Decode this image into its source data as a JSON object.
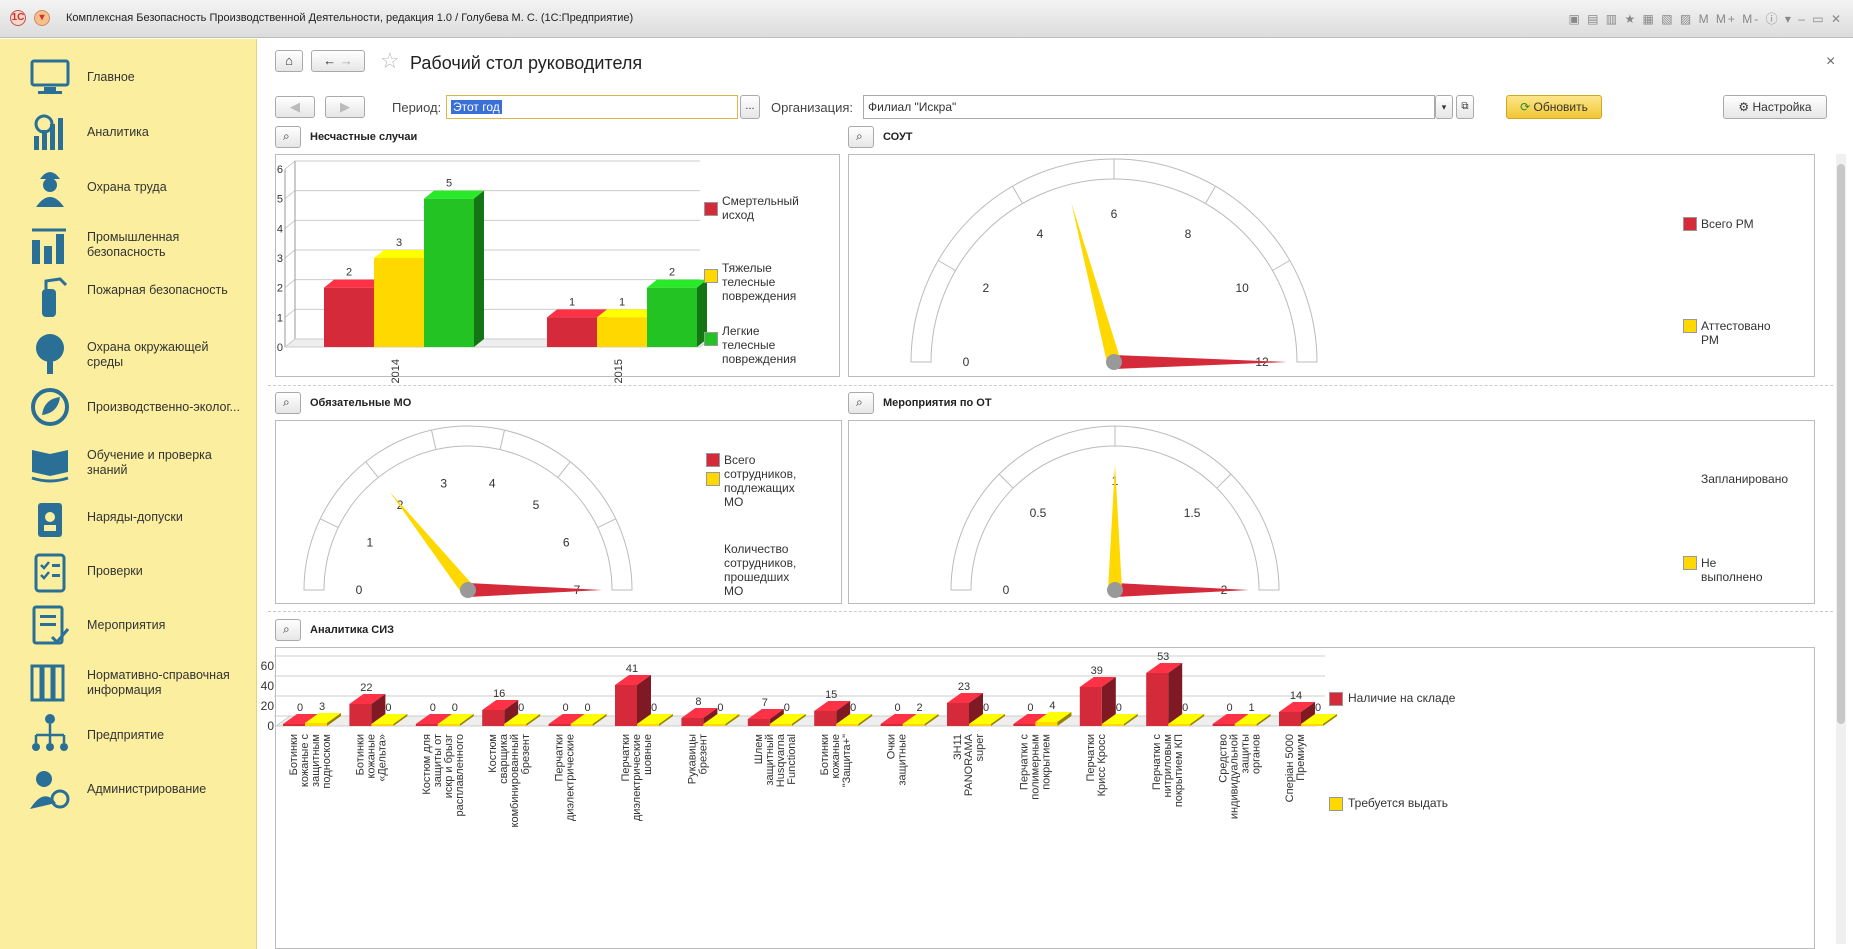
{
  "window": {
    "title": "Комплексная Безопасность Производственной Деятельности, редакция 1.0 / Голубева М. С.  (1С:Предприятие)"
  },
  "sidebar": {
    "items": [
      {
        "label": "Главное",
        "icon": "monitor-icon"
      },
      {
        "label": "Аналитика",
        "icon": "analytics-icon"
      },
      {
        "label": "Охрана труда",
        "icon": "worker-icon"
      },
      {
        "label": "Промышленная безопасность",
        "icon": "factory-icon"
      },
      {
        "label": "Пожарная безопасность",
        "icon": "extinguisher-icon"
      },
      {
        "label": "Охрана окружающей среды",
        "icon": "tree-icon"
      },
      {
        "label": "Производственно-эколог...",
        "icon": "eco-icon"
      },
      {
        "label": "Обучение и проверка знаний",
        "icon": "book-icon"
      },
      {
        "label": "Наряды-допуски",
        "icon": "badge-icon"
      },
      {
        "label": "Проверки",
        "icon": "checklist-icon"
      },
      {
        "label": "Мероприятия",
        "icon": "document-icon"
      },
      {
        "label": "Нормативно-справочная информация",
        "icon": "binders-icon"
      },
      {
        "label": "Предприятие",
        "icon": "org-chart-icon"
      },
      {
        "label": "Администрирование",
        "icon": "admin-icon"
      }
    ]
  },
  "header": {
    "title": "Рабочий стол руководителя",
    "close": "×"
  },
  "toolbar": {
    "period_label": "Период:",
    "period_value": "Этот год",
    "period_more": "...",
    "org_label": "Организация:",
    "org_value": "Филиал \"Искра\"",
    "refresh_label": "Обновить",
    "settings_label": "Настройка"
  },
  "colors": {
    "red": "#d42a3a",
    "yellow": "#ffd800",
    "green": "#22c322",
    "accent": "#f9d74a"
  },
  "panels": {
    "accidents": {
      "title": "Несчастные случаи"
    },
    "sout": {
      "title": "СОУТ"
    },
    "mo": {
      "title": "Обязательные МО"
    },
    "ot": {
      "title": "Мероприятия по ОТ"
    },
    "siz": {
      "title": "Аналитика СИЗ"
    }
  },
  "chart_data": [
    {
      "type": "bar",
      "title": "Несчастные случаи",
      "categories": [
        "2014",
        "2015"
      ],
      "series": [
        {
          "name": "Смертельный исход",
          "values": [
            2,
            1
          ]
        },
        {
          "name": "Тяжелые телесные повреждения",
          "values": [
            3,
            1
          ]
        },
        {
          "name": "Легкие телесные повреждения",
          "values": [
            5,
            2
          ]
        }
      ],
      "ylim": [
        0,
        6
      ],
      "yticks": [
        "0",
        "1",
        "2",
        "3",
        "4",
        "5",
        "6"
      ],
      "legend": "right"
    },
    {
      "type": "gauge",
      "title": "СОУТ",
      "range": [
        0,
        12
      ],
      "ticks": [
        "0",
        "2",
        "4",
        "6",
        "8",
        "10",
        "12"
      ],
      "series": [
        {
          "name": "Всего РМ",
          "value": 12
        },
        {
          "name": "Аттестовано РМ",
          "value": 5
        }
      ],
      "legend": "right"
    },
    {
      "type": "gauge",
      "title": "Обязательные МО",
      "range": [
        0,
        7
      ],
      "ticks": [
        "0",
        "1",
        "2",
        "3",
        "4",
        "5",
        "6",
        "7"
      ],
      "series": [
        {
          "name": "Всего сотрудников, подлежащих МО",
          "value": 7
        },
        {
          "name": "Количество сотрудников, прошедших МО",
          "value": 2
        }
      ],
      "legend": "right"
    },
    {
      "type": "gauge",
      "title": "Мероприятия по ОТ",
      "range": [
        0,
        2
      ],
      "ticks": [
        "0",
        "0.5",
        "1",
        "1.5",
        "2"
      ],
      "series": [
        {
          "name": "Запланировано",
          "value": 2
        },
        {
          "name": "Не выполнено",
          "value": 1
        }
      ],
      "legend": "right"
    },
    {
      "type": "bar",
      "title": "Аналитика СИЗ",
      "categories": [
        "Ботинки кожаные с защитным подноском для защиты от п...",
        "Ботинки кожаные «Дельта»",
        "Костюм для защиты от искр и брызг расплавленного металла",
        "Костюм сварщика комбинированный брезент",
        "Перчатки диэлектрические",
        "Перчатки диэлектрические шовные",
        "Рукавицы брезент",
        "Шлем защитный Husqvarna Functional",
        "Ботинки кожаные \"Защита+\"",
        "Очки защитные",
        "ЗН11 PANORAMA super",
        "Перчатки с полимерным покрытием",
        "Перчатки Крисс Кросс",
        "Перчатки с нитриловым покрытием КП",
        "Средство индивидуальной защиты органов дыхания фи...",
        "Сперіан 5000 Премиум"
      ],
      "series": [
        {
          "name": "Наличие на складе",
          "values": [
            0,
            22,
            0,
            16,
            0,
            41,
            8,
            7,
            15,
            0,
            23,
            0,
            39,
            53,
            0,
            14
          ]
        },
        {
          "name": "Требуется выдать",
          "values": [
            3,
            0,
            0,
            0,
            0,
            0,
            0,
            0,
            0,
            2,
            0,
            4,
            0,
            0,
            1,
            0
          ]
        }
      ],
      "ylim": [
        0,
        60
      ],
      "yticks": [
        "0",
        "20",
        "40",
        "60"
      ],
      "legend": "right"
    }
  ]
}
